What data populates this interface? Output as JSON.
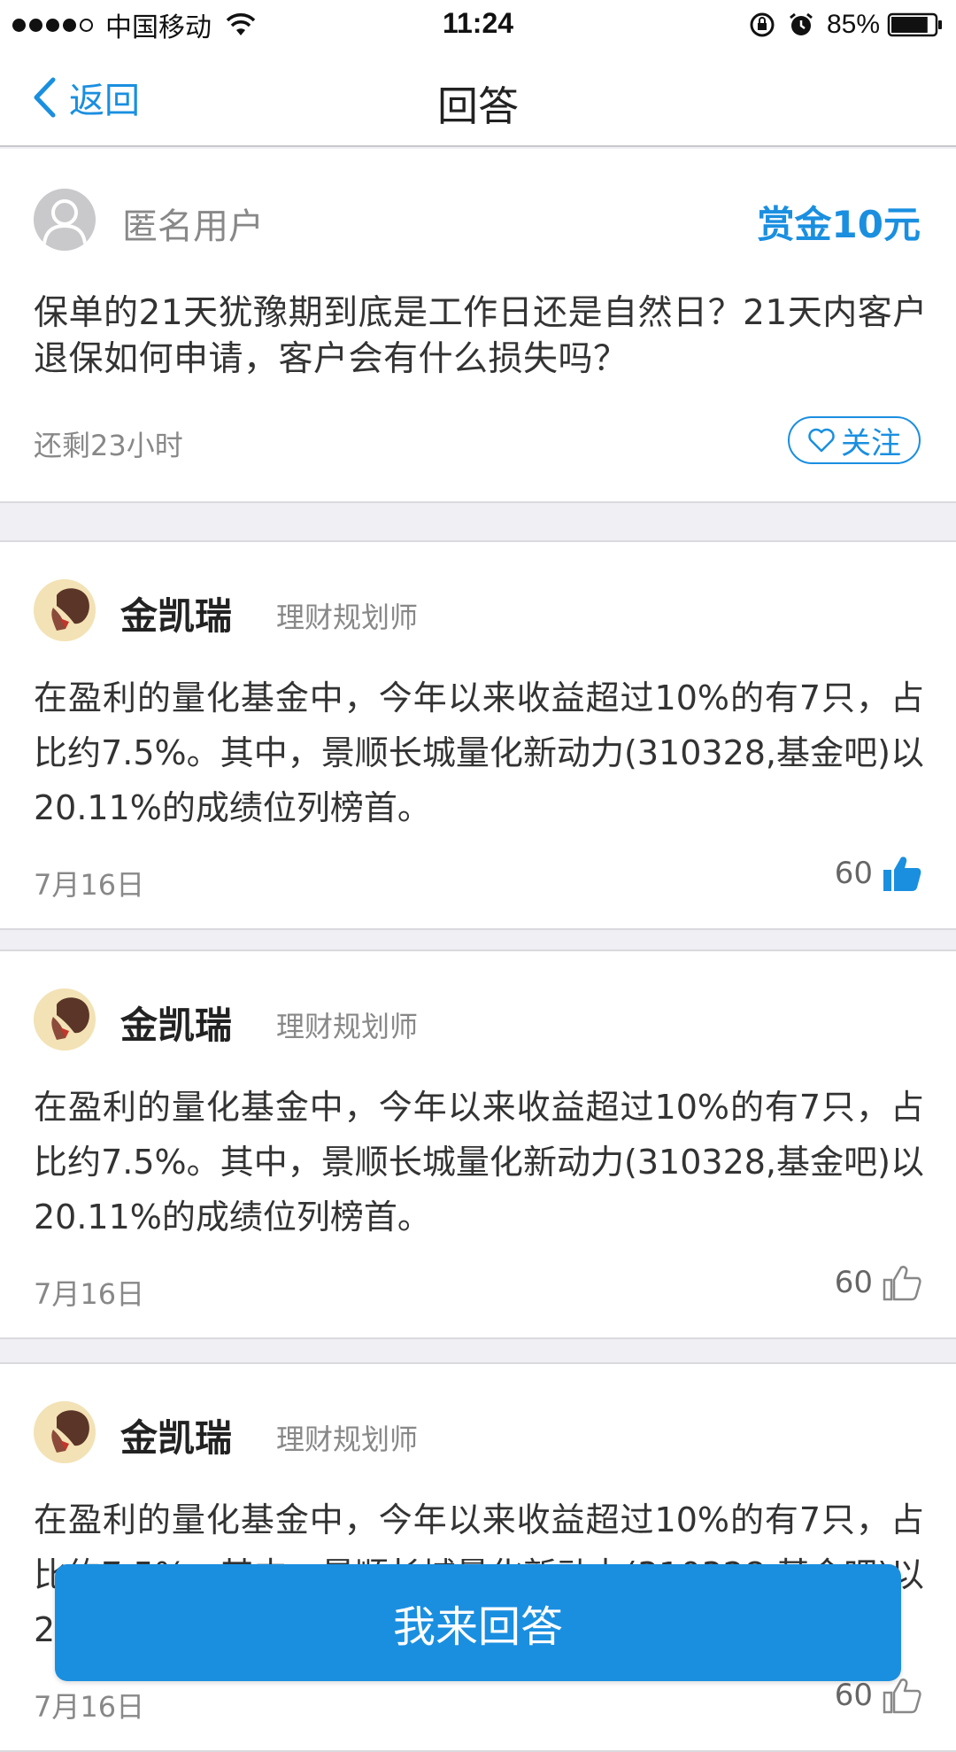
{
  "status_bar": {
    "carrier": "中国移动",
    "time": "11:24",
    "battery": "85%",
    "battery_level": 0.85,
    "signal_bars": 4
  },
  "nav": {
    "back_label": "返回",
    "title": "回答"
  },
  "question": {
    "user": "匿名用户",
    "bounty": "赏金10元",
    "text": "保单的21天犹豫期到底是工作日还是自然日？21天内客户退保如何申请，客户会有什么损失吗？",
    "remaining": "还剩23小时",
    "follow_label": "关注"
  },
  "answers": [
    {
      "name": "金凯瑞",
      "role": "理财规划师",
      "text": "在盈利的量化基金中，今年以来收益超过10%的有7只，占比约7.5%。其中，景顺长城量化新动力(310328,基金吧)以20.11%的成绩位列榜首。",
      "date": "7月16日",
      "likes": "60",
      "liked": true
    },
    {
      "name": "金凯瑞",
      "role": "理财规划师",
      "text": "在盈利的量化基金中，今年以来收益超过10%的有7只，占比约7.5%。其中，景顺长城量化新动力(310328,基金吧)以20.11%的成绩位列榜首。",
      "date": "7月16日",
      "likes": "60",
      "liked": false
    },
    {
      "name": "金凯瑞",
      "role": "理财规划师",
      "text": "在盈利的量化基金中，今年以来收益超过10%的有7只，占比约7.5%。其中，景顺长城量化新动力(310328,基金吧)以20.11%的成绩位列榜首。",
      "date": "7月16日",
      "likes": "60",
      "liked": false
    }
  ],
  "answer_button": "我来回答",
  "colors": {
    "accent": "#1a8fe0",
    "background": "#efeff4"
  }
}
